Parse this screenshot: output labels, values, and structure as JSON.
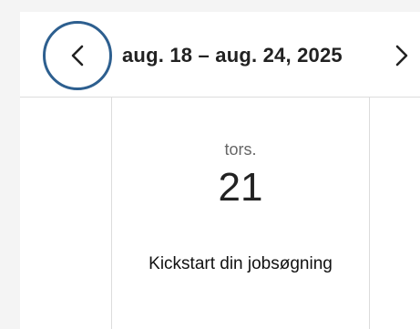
{
  "header": {
    "date_range": "aug. 18 – aug. 24, 2025",
    "prev_icon": "chevron-left-icon",
    "next_icon": "chevron-right-icon",
    "focus_ring_color": "#2d5f8f"
  },
  "day": {
    "weekday": "tors.",
    "date": "21",
    "events": [
      {
        "title": "Kickstart din jobsøgning"
      }
    ]
  }
}
